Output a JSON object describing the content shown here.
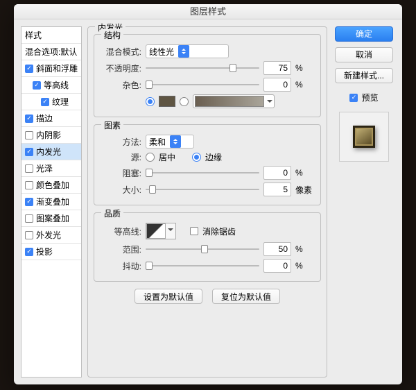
{
  "window": {
    "title": "图层样式"
  },
  "sidebar": {
    "header_styles": "样式",
    "header_blend": "混合选项:默认",
    "items": [
      {
        "label": "斜面和浮雕",
        "checked": true,
        "indent": 0
      },
      {
        "label": "等高线",
        "checked": true,
        "indent": 1
      },
      {
        "label": "纹理",
        "checked": true,
        "indent": 2
      },
      {
        "label": "描边",
        "checked": true,
        "indent": 0
      },
      {
        "label": "内阴影",
        "checked": false,
        "indent": 0
      },
      {
        "label": "内发光",
        "checked": true,
        "indent": 0,
        "selected": true
      },
      {
        "label": "光泽",
        "checked": false,
        "indent": 0
      },
      {
        "label": "颜色叠加",
        "checked": false,
        "indent": 0
      },
      {
        "label": "渐变叠加",
        "checked": true,
        "indent": 0
      },
      {
        "label": "图案叠加",
        "checked": false,
        "indent": 0
      },
      {
        "label": "外发光",
        "checked": false,
        "indent": 0
      },
      {
        "label": "投影",
        "checked": true,
        "indent": 0
      }
    ]
  },
  "panel": {
    "title": "内发光"
  },
  "structure": {
    "title": "结构",
    "blend_label": "混合模式:",
    "blend_value": "线性光",
    "opacity_label": "不透明度:",
    "opacity_value": "75",
    "opacity_unit": "%",
    "noise_label": "杂色:",
    "noise_value": "0",
    "noise_unit": "%",
    "color_swatch": "#5f5543"
  },
  "elements": {
    "title": "图素",
    "technique_label": "方法:",
    "technique_value": "柔和",
    "source_label": "源:",
    "source_center": "居中",
    "source_edge": "边缘",
    "choke_label": "阻塞:",
    "choke_value": "0",
    "choke_unit": "%",
    "size_label": "大小:",
    "size_value": "5",
    "size_unit": "像素"
  },
  "quality": {
    "title": "品质",
    "contour_label": "等高线:",
    "antialias_label": "消除锯齿",
    "range_label": "范围:",
    "range_value": "50",
    "range_unit": "%",
    "jitter_label": "抖动:",
    "jitter_value": "0",
    "jitter_unit": "%"
  },
  "buttons": {
    "set_default": "设置为默认值",
    "reset_default": "复位为默认值"
  },
  "right": {
    "ok": "确定",
    "cancel": "取消",
    "new_style": "新建样式...",
    "preview": "预览"
  }
}
